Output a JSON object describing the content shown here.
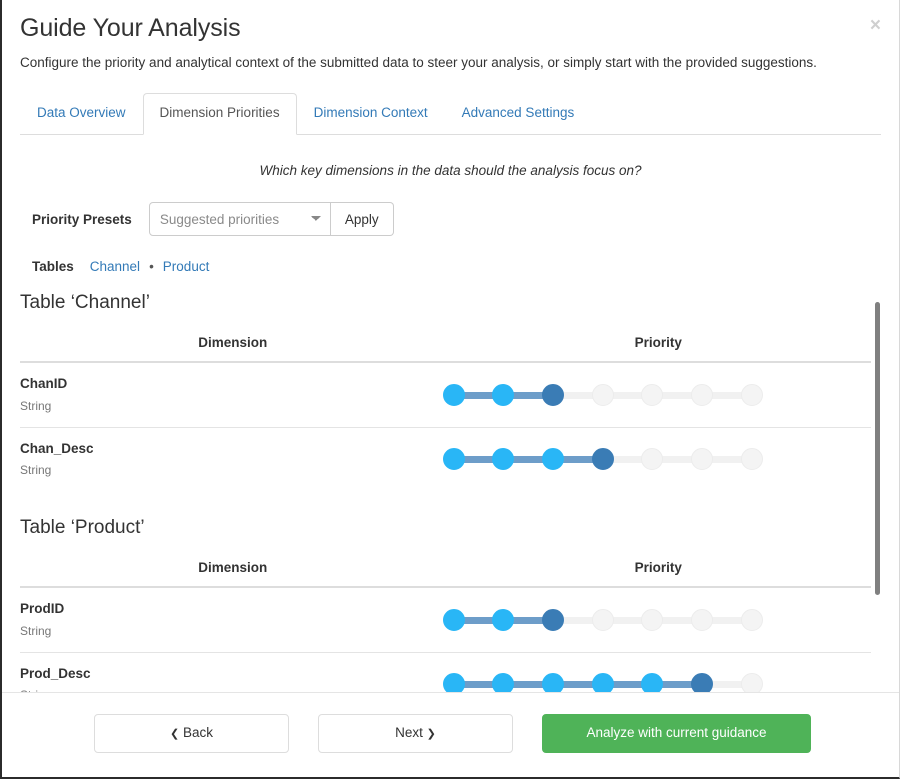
{
  "header": {
    "title": "Guide Your Analysis",
    "subtitle": "Configure the priority and analytical context of the submitted data to steer your analysis, or simply start with the provided suggestions.",
    "close_label": "×"
  },
  "tabs": [
    {
      "label": "Data Overview",
      "active": false
    },
    {
      "label": "Dimension Priorities",
      "active": true
    },
    {
      "label": "Dimension Context",
      "active": false
    },
    {
      "label": "Advanced Settings",
      "active": false
    }
  ],
  "question": "Which key dimensions in the data should the analysis focus on?",
  "presets": {
    "label": "Priority Presets",
    "selected": "Suggested priorities",
    "options": [
      "Suggested priorities"
    ],
    "apply_label": "Apply"
  },
  "tables_nav": {
    "label": "Tables",
    "links": [
      "Channel",
      "Product"
    ],
    "separator": "•"
  },
  "columns": {
    "dimension": "Dimension",
    "priority": "Priority"
  },
  "slider": {
    "steps": 7,
    "color_on": "#29b6f6",
    "color_handle": "#3a7cb5",
    "color_fill": "#6d9dc9",
    "color_off": "#f4f4f4"
  },
  "tables": [
    {
      "title": "Table ‘Channel’",
      "rows": [
        {
          "name": "ChanID",
          "type": "String",
          "priority": 3
        },
        {
          "name": "Chan_Desc",
          "type": "String",
          "priority": 4
        }
      ]
    },
    {
      "title": "Table ‘Product’",
      "rows": [
        {
          "name": "ProdID",
          "type": "String",
          "priority": 3
        },
        {
          "name": "Prod_Desc",
          "type": "String",
          "priority": 6
        }
      ]
    }
  ],
  "footer": {
    "back_label": "Back",
    "next_label": "Next",
    "analyze_label": "Analyze with current guidance",
    "back_icon": "❮",
    "next_icon": "❯",
    "accent_green": "#4fb358"
  }
}
